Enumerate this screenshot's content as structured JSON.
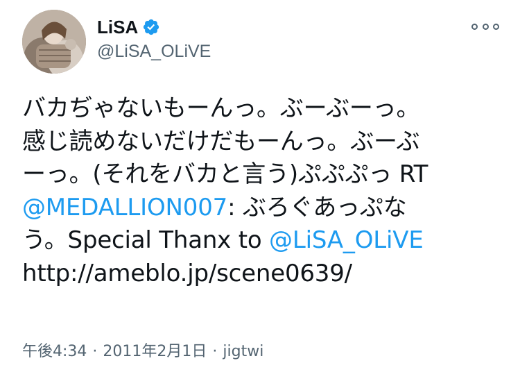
{
  "user": {
    "display_name": "LiSA",
    "handle": "@LiSA_OLiVE",
    "verified": true,
    "avatar_icon": "profile-photo"
  },
  "menu": {
    "icon": "more-options-icon"
  },
  "tweet": {
    "line1": "バカぢゃないもーんっ。ぶーぶーっ。",
    "line2": "感じ読めないだけだもーんっ。ぶーぶ",
    "line3": "ーっ。(それをバカと言う)ぷぷぷっ RT",
    "mention1": "@MEDALLION007",
    "line4_rest": ": ぶろぐあっぷな",
    "line5_pre": "う。Special Thanx to ",
    "mention2": "@LiSA_OLiVE",
    "url": "http://ameblo.jp/scene0639/"
  },
  "meta": {
    "time": "午後4:34",
    "separator": "·",
    "date": "2011年2月1日",
    "source": "jigtwi"
  },
  "colors": {
    "link": "#1d9bf0",
    "verified": "#1d9bf0",
    "secondary_text": "#536471",
    "primary_text": "#0f1419"
  }
}
